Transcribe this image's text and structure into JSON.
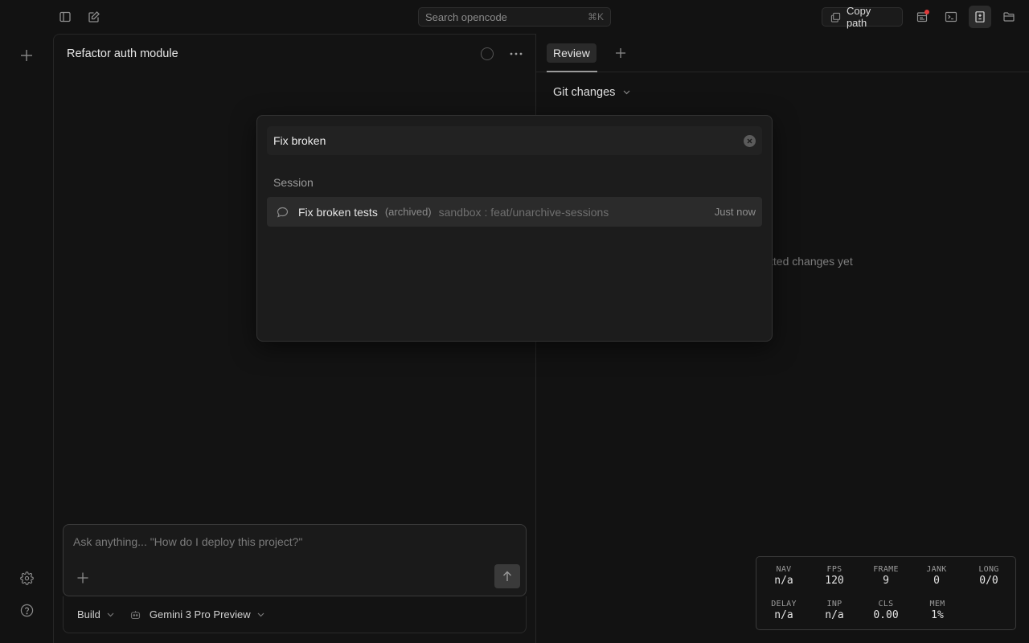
{
  "topbar": {
    "search_placeholder": "Search opencode",
    "search_shortcut": "⌘K",
    "copy_path_label": "Copy path"
  },
  "session": {
    "title": "Refactor auth module",
    "composer_placeholder": "Ask anything... \"How do I deploy this project?\"",
    "mode": "Build",
    "model": "Gemini 3 Pro Preview"
  },
  "review": {
    "tab_label": "Review",
    "section_label": "Git changes",
    "empty_text": "tted changes yet"
  },
  "dialog": {
    "query": "Fix broken",
    "group_label": "Session",
    "results": [
      {
        "title": "Fix broken tests",
        "status": "(archived)",
        "meta": "sandbox : feat/unarchive-sessions",
        "time": "Just now"
      }
    ]
  },
  "perf": {
    "nav": {
      "label": "NAV",
      "value": "n/a"
    },
    "fps": {
      "label": "FPS",
      "value": "120"
    },
    "frame": {
      "label": "FRAME",
      "value": "9"
    },
    "jank": {
      "label": "JANK",
      "value": "0"
    },
    "long": {
      "label": "LONG",
      "value": "0/0"
    },
    "delay": {
      "label": "DELAY",
      "value": "n/a"
    },
    "inp": {
      "label": "INP",
      "value": "n/a"
    },
    "cls": {
      "label": "CLS",
      "value": "0.00"
    },
    "mem": {
      "label": "MEM",
      "value": "1%"
    }
  },
  "colors": {
    "background": "#121212",
    "panel": "#1c1c1c",
    "notification_dot": "#e23a3a"
  }
}
